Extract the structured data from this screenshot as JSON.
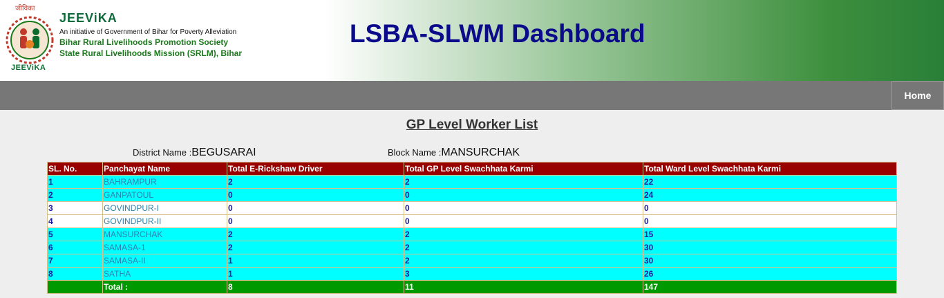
{
  "header": {
    "logo_top_text": "जीविका",
    "logo_bottom_text": "JEEViKA",
    "org_name": "JEEViKA",
    "org_line1": "An initiative of Government of Bihar for Poverty Alleviation",
    "org_line2": "Bihar Rural Livelihoods Promotion Society",
    "org_line3": "State Rural Livelihoods Mission (SRLM), Bihar",
    "dashboard_title": "LSBA-SLWM Dashboard"
  },
  "nav": {
    "home_label": "Home"
  },
  "page": {
    "title": "GP Level Worker List",
    "district_label": "District Name :",
    "district_value": "BEGUSARAI",
    "block_label": "Block Name :",
    "block_value": "MANSURCHAK"
  },
  "table": {
    "headers": [
      "SL. No.",
      "Panchayat Name",
      "Total E-Rickshaw Driver",
      "Total GP Level Swachhata Karmi",
      "Total Ward Level Swachhata Karmi"
    ],
    "rows": [
      {
        "sl": "1",
        "name": "BAHRAMPUR",
        "erickshaw": "2",
        "gp": "2",
        "ward": "22",
        "style": "cyan"
      },
      {
        "sl": "2",
        "name": "GANPATOUL",
        "erickshaw": "0",
        "gp": "0",
        "ward": "24",
        "style": "cyan"
      },
      {
        "sl": "3",
        "name": "GOVINDPUR-I",
        "erickshaw": "0",
        "gp": "0",
        "ward": "0",
        "style": "white"
      },
      {
        "sl": "4",
        "name": "GOVINDPUR-II",
        "erickshaw": "0",
        "gp": "0",
        "ward": "0",
        "style": "white"
      },
      {
        "sl": "5",
        "name": "MANSURCHAK",
        "erickshaw": "2",
        "gp": "2",
        "ward": "15",
        "style": "cyan"
      },
      {
        "sl": "6",
        "name": "SAMASA-1",
        "erickshaw": "2",
        "gp": "2",
        "ward": "30",
        "style": "cyan"
      },
      {
        "sl": "7",
        "name": "SAMASA-II",
        "erickshaw": "1",
        "gp": "2",
        "ward": "30",
        "style": "cyan"
      },
      {
        "sl": "8",
        "name": "SATHA",
        "erickshaw": "1",
        "gp": "3",
        "ward": "26",
        "style": "cyan"
      }
    ],
    "total": {
      "label": "Total :",
      "erickshaw": "8",
      "gp": "11",
      "ward": "147"
    }
  },
  "colors": {
    "header_row": "#990000",
    "row_cyan": "#00ffff",
    "total_row": "#009900",
    "title_blue": "#0a0a8a"
  }
}
